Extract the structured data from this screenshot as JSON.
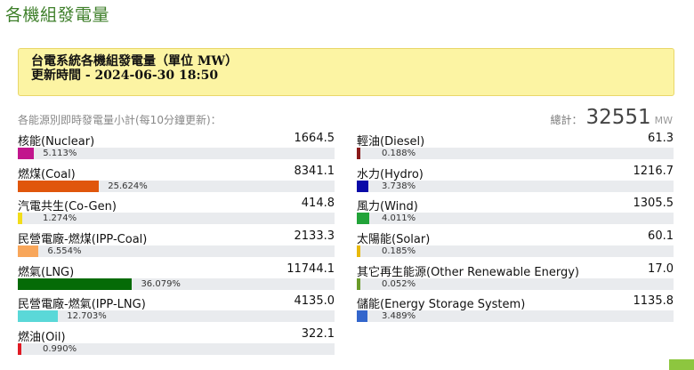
{
  "page_title": "各機組發電量",
  "notice": {
    "line1": "台電系統各機組發電量（單位 MW）",
    "line2": "更新時間 - 2024-06-30 18:50"
  },
  "subtitle": "各能源別即時發電量小計(每10分鐘更新)：",
  "total": {
    "label": "總計：",
    "value": "32551",
    "unit": "MW"
  },
  "left_sources": [
    {
      "name": "核能(Nuclear)",
      "value": "1664.5",
      "percent": "5.113%",
      "fraction": 0.05113,
      "color": "#c2168d"
    },
    {
      "name": "燃煤(Coal)",
      "value": "8341.1",
      "percent": "25.624%",
      "fraction": 0.25624,
      "color": "#e0560c"
    },
    {
      "name": "汽電共生(Co-Gen)",
      "value": "414.8",
      "percent": "1.274%",
      "fraction": 0.01274,
      "color": "#f2dd1a"
    },
    {
      "name": "民營電廠-燃煤(IPP-Coal)",
      "value": "2133.3",
      "percent": "6.554%",
      "fraction": 0.06554,
      "color": "#f8a65a"
    },
    {
      "name": "燃氣(LNG)",
      "value": "11744.1",
      "percent": "36.079%",
      "fraction": 0.36079,
      "color": "#056b07"
    },
    {
      "name": "民營電廠-燃氣(IPP-LNG)",
      "value": "4135.0",
      "percent": "12.703%",
      "fraction": 0.12703,
      "color": "#5ad8d8"
    },
    {
      "name": "燃油(Oil)",
      "value": "322.1",
      "percent": "0.990%",
      "fraction": 0.0099,
      "color": "#e01b24"
    }
  ],
  "right_sources": [
    {
      "name": "輕油(Diesel)",
      "value": "61.3",
      "percent": "0.188%",
      "fraction": 0.00188,
      "color": "#8a1a1a"
    },
    {
      "name": "水力(Hydro)",
      "value": "1216.7",
      "percent": "3.738%",
      "fraction": 0.03738,
      "color": "#0a0aa8"
    },
    {
      "name": "風力(Wind)",
      "value": "1305.5",
      "percent": "4.011%",
      "fraction": 0.04011,
      "color": "#22a339"
    },
    {
      "name": "太陽能(Solar)",
      "value": "60.1",
      "percent": "0.185%",
      "fraction": 0.00185,
      "color": "#e8b90b"
    },
    {
      "name": "其它再生能源(Other Renewable Energy)",
      "value": "17.0",
      "percent": "0.052%",
      "fraction": 0.00052,
      "color": "#6a9b2a"
    },
    {
      "name": "儲能(Energy Storage System)",
      "value": "1135.8",
      "percent": "3.489%",
      "fraction": 0.03489,
      "color": "#3366cc"
    }
  ]
}
